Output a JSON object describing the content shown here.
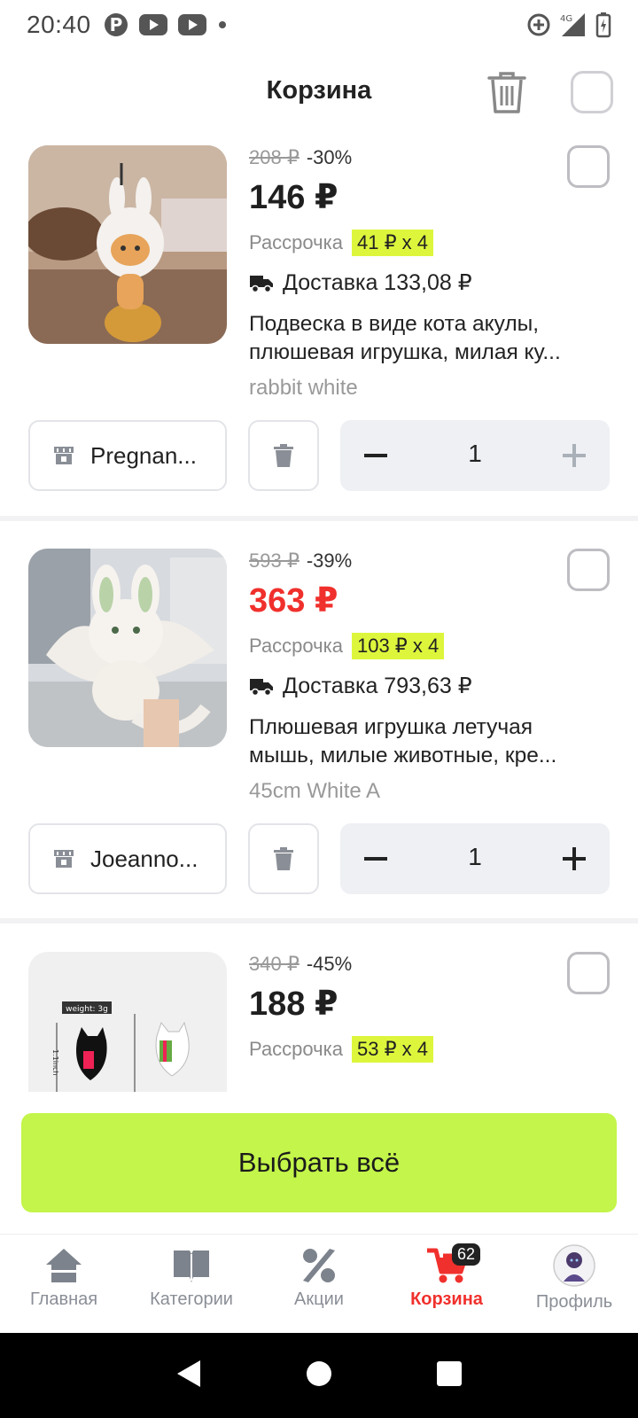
{
  "status": {
    "time": "20:40",
    "network": "4G"
  },
  "header": {
    "title": "Корзина"
  },
  "items": [
    {
      "old_price": "208 ₽",
      "discount": "-30%",
      "price": "146 ₽",
      "installment_label": "Рассрочка",
      "installment": "41 ₽ x 4",
      "delivery": "Доставка 133,08 ₽",
      "name": "Подвеска в виде кота акулы, плюшевая игрушка, милая ку...",
      "variant": "rabbit white",
      "shop": "Pregnan...",
      "qty": "1"
    },
    {
      "old_price": "593 ₽",
      "discount": "-39%",
      "price": "363 ₽",
      "installment_label": "Рассрочка",
      "installment": "103 ₽ x 4",
      "delivery": "Доставка 793,63 ₽",
      "name": "Плюшевая игрушка летучая мышь, милые животные, кре...",
      "variant": "45cm White A",
      "shop": "Joeanno...",
      "qty": "1"
    },
    {
      "old_price": "340 ₽",
      "discount": "-45%",
      "price": "188 ₽",
      "installment_label": "Рассрочка",
      "installment": "53 ₽ x 4",
      "image_text": {
        "weight": "weight: 3g",
        "size": "1.1inch"
      }
    }
  ],
  "select_all_label": "Выбрать всё",
  "tabbar": {
    "tabs": [
      {
        "label": "Главная",
        "icon": "home-icon"
      },
      {
        "label": "Категории",
        "icon": "book-icon"
      },
      {
        "label": "Акции",
        "icon": "percent-icon"
      },
      {
        "label": "Корзина",
        "icon": "cart-icon",
        "badge": "62",
        "active": true
      },
      {
        "label": "Профиль",
        "icon": "avatar"
      }
    ]
  },
  "colors": {
    "accent_green": "#c3f54a",
    "badge_yellow": "#ddf63c",
    "sale_red": "#f0302c"
  }
}
